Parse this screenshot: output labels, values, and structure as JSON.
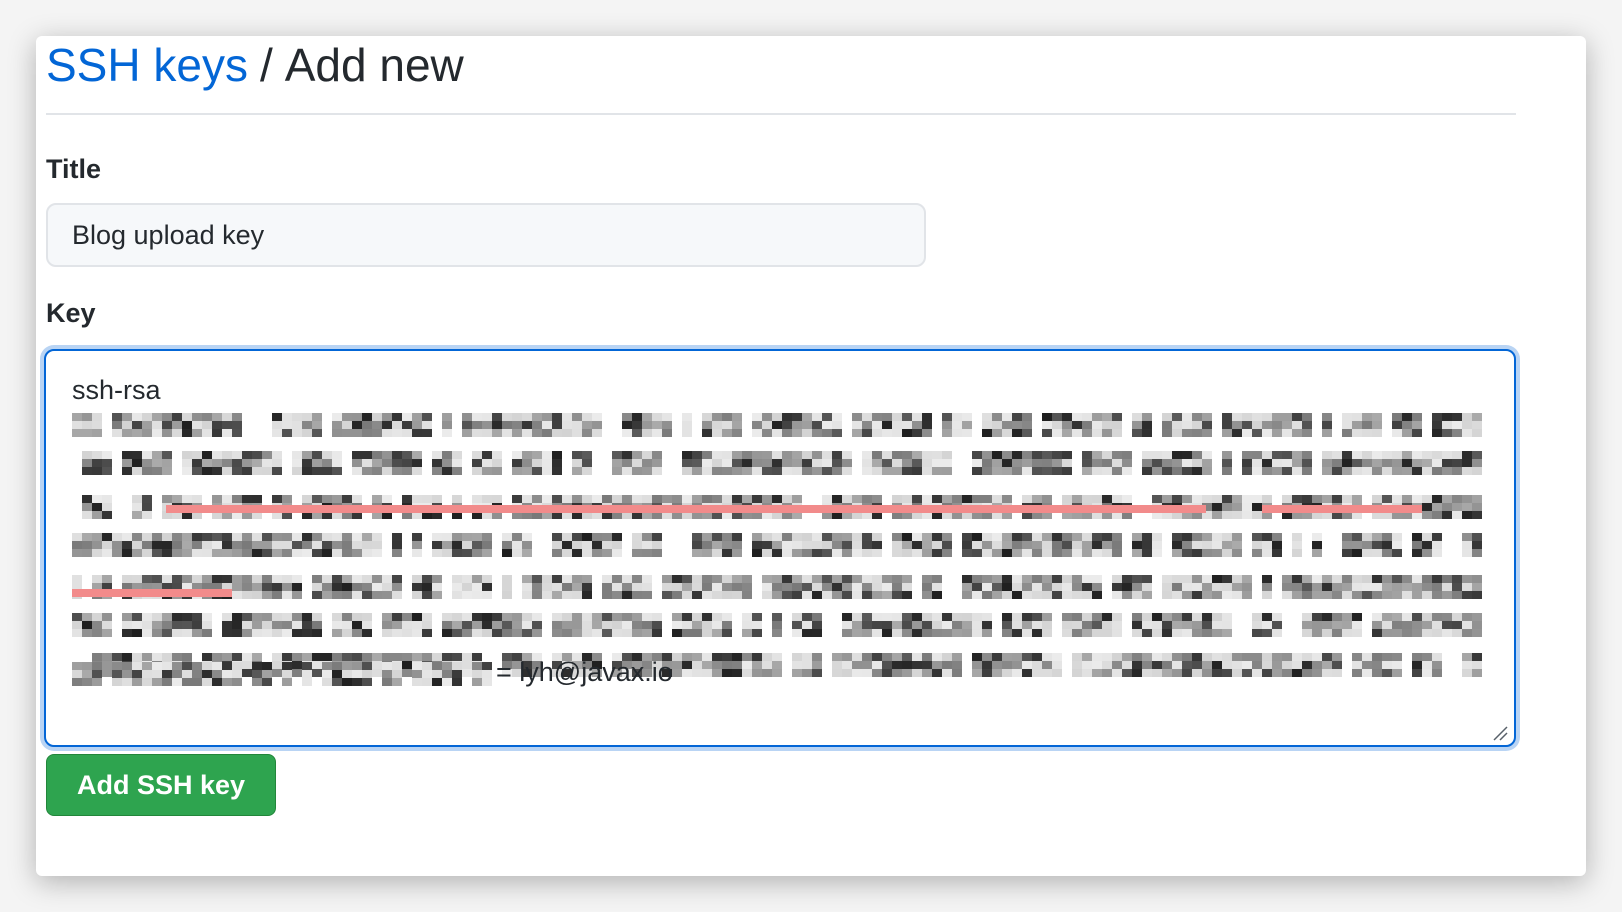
{
  "breadcrumb": {
    "link_label": "SSH keys",
    "separator": "/",
    "current": "Add new"
  },
  "form": {
    "title_label": "Title",
    "title_value": "Blog upload key",
    "key_label": "Key",
    "key_first_line": "ssh-rsa",
    "key_last_text": "= lyh@javax.io",
    "submit_label": "Add SSH key"
  },
  "icons": {
    "resize": "resize-grip-icon"
  },
  "colors": {
    "link": "#0366d6",
    "focus_border": "#0366d6",
    "submit_bg": "#2ea44f",
    "redaction_highlight": "#f28b8b"
  }
}
